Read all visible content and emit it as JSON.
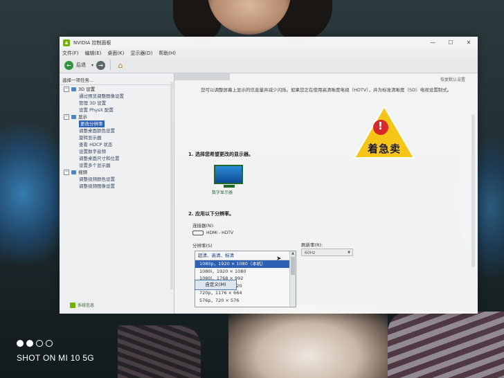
{
  "window": {
    "title": "NVIDIA 控制面板",
    "controls": {
      "minimize": "—",
      "maximize": "☐",
      "close": "✕"
    }
  },
  "menu": [
    "文件(F)",
    "编辑(E)",
    "桌面(K)",
    "显示器(D)",
    "帮助(H)"
  ],
  "toolbar": {
    "back_label": "后退",
    "dropdown": "▾"
  },
  "left_pane": {
    "task_label": "选择一项任务...",
    "tree": [
      {
        "label": "3D 设置",
        "level": "cat"
      },
      {
        "label": "通过预览调整图像设置",
        "level": "sub"
      },
      {
        "label": "管理 3D 设置",
        "level": "sub"
      },
      {
        "label": "设置 PhysX 配置",
        "level": "sub"
      },
      {
        "label": "显示",
        "level": "cat"
      },
      {
        "label": "更改分辨率",
        "level": "sub",
        "selected": true
      },
      {
        "label": "调整桌面颜色设置",
        "level": "sub"
      },
      {
        "label": "旋转显示器",
        "level": "sub"
      },
      {
        "label": "查看 HDCP 状态",
        "level": "sub"
      },
      {
        "label": "设置数字音频",
        "level": "sub"
      },
      {
        "label": "调整桌面尺寸和位置",
        "level": "sub"
      },
      {
        "label": "设置多个显示器",
        "level": "sub"
      },
      {
        "label": "视频",
        "level": "cat"
      },
      {
        "label": "调整视频颜色设置",
        "level": "sub"
      },
      {
        "label": "调整视频图像设置",
        "level": "sub"
      }
    ],
    "footer": "系统信息"
  },
  "right_pane": {
    "restore_defaults": "恢复默认设置",
    "intro": "您可以调整屏幕上显示的信息量并减少闪烁。如果您正在使用高清晰度电视（HDTV），并为标准清晰度（SD）电视设置制式。",
    "step1": "1. 选择您希望更改的显示器。",
    "monitor_label": "数字显示器",
    "step2": "2. 应用以下分辨率。",
    "connector_label": "连接器(N):",
    "connector_value": "HDMI - HDTV",
    "resolution_label": "分辨率(S)",
    "refresh_label": "刷新率(R):",
    "refresh_value": "60Hz",
    "res_group": "超清、高清、标清",
    "resolutions": [
      "1080p，1920 × 1080（本机）",
      "1080i，1920 × 1080",
      "1080i，1768 × 992",
      "720p，1280 × 720",
      "720p，1176 × 664",
      "576p，720 × 576"
    ],
    "selected_resolution_index": 0,
    "custom_button": "自定义(M)"
  },
  "sticker": {
    "text": "着急卖",
    "mark": "!",
    "color": "#f5c518"
  },
  "watermark": {
    "text": "SHOT ON MI 10 5G"
  }
}
